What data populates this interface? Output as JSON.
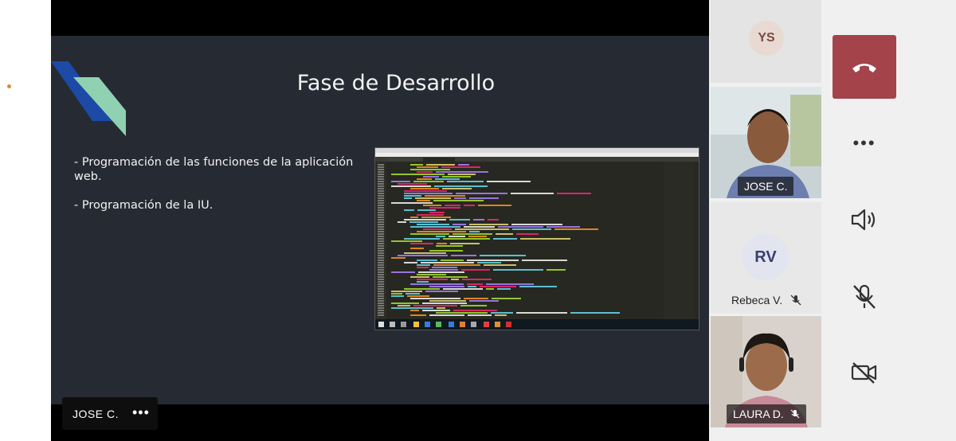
{
  "slide": {
    "title": "Fase de Desarrollo",
    "bullets": [
      "- Programación de las funciones de la aplicación web.",
      "- Programación de la IU."
    ]
  },
  "presenter": {
    "name": "JOSE C.",
    "more": "•••"
  },
  "participants": [
    {
      "initials": "YS",
      "name": ""
    },
    {
      "name": "JOSE C.",
      "video": true,
      "active": true
    },
    {
      "initials": "RV",
      "name": "Rebeca V.",
      "muted": true
    },
    {
      "name": "LAURA D.",
      "video": true,
      "muted": true
    }
  ],
  "controls": {
    "hangup_icon": "phone-hangup-icon",
    "more_label": "•••",
    "speaker_icon": "speaker-icon",
    "mic_icon": "mic-off-icon",
    "camera_icon": "camera-off-icon"
  },
  "colors": {
    "slide_bg": "#262a33",
    "hangup": "#a4434a",
    "active_speaker": "#7b6fb6",
    "deco_blue": "#1c4aa6",
    "deco_green": "#8fd1b0"
  }
}
